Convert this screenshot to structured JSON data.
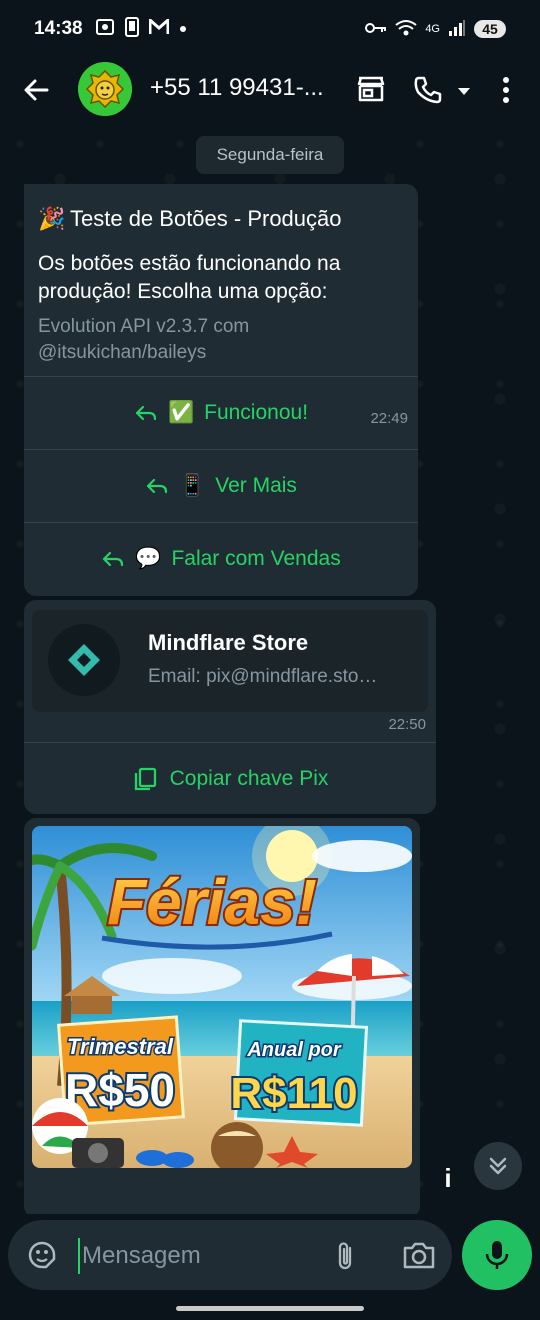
{
  "status_bar": {
    "time": "14:38",
    "left_icons": [
      "screenshot-icon",
      "phone-frame-icon",
      "gmail-icon",
      "dot-icon"
    ],
    "network": "4G",
    "battery": "45"
  },
  "header": {
    "contact": "+55 11 99431-..."
  },
  "chat": {
    "date_chip": "Segunda-feira",
    "message1": {
      "title_emoji": "🎉",
      "title": "Teste de Botões - Produção",
      "body": "Os botões estão funcionando na produção! Escolha uma opção:",
      "footer": "Evolution API v2.3.7 com @itsukichan/baileys",
      "time": "22:49",
      "buttons": [
        {
          "emoji": "✅",
          "label": "Funcionou!"
        },
        {
          "emoji": "📱",
          "label": "Ver Mais"
        },
        {
          "emoji": "💬",
          "label": "Falar com Vendas"
        }
      ]
    },
    "message2": {
      "store_name": "Mindflare Store",
      "store_email": "Email: pix@mindflare.sto…",
      "time": "22:50",
      "copy_label": "Copiar chave Pix"
    },
    "message3": {
      "headline": "Férias!",
      "offer1_label": "Trimestral",
      "offer1_price": "R$50",
      "offer2_label": "Anual por",
      "offer2_price": "R$110"
    }
  },
  "composer": {
    "placeholder": "Mensagem"
  },
  "colors": {
    "accent": "#25d366",
    "bubble": "#202c33",
    "background": "#0b141a"
  }
}
